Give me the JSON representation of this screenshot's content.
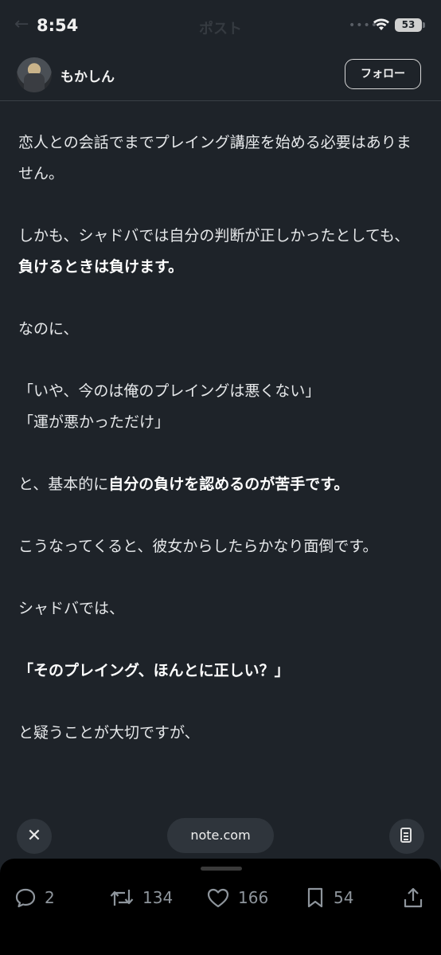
{
  "status_bar": {
    "time": "8:54",
    "title": "ポスト",
    "battery": "53",
    "back_glyph": "←",
    "dots": "••••"
  },
  "header": {
    "username": "もかしん",
    "follow_label": "フォロー"
  },
  "article": {
    "p1": "恋人との会話でまでプレイング講座を始める必要はありません。",
    "p2_plain": "しかも、シャドバでは自分の判断が正しかったとしても、",
    "p2_bold": "負けるときは負けます。",
    "p3": "なのに、",
    "p4_line1": "「いや、今のは俺のプレイングは悪くない」",
    "p4_line2": "「運が悪かっただけ」",
    "p5_plain": "と、基本的に",
    "p5_bold": "自分の負けを認めるのが苦手です。",
    "p6": "こうなってくると、彼女からしたらかなり面倒です。",
    "p7": "シャドバでは、",
    "p8_bold": "「そのプレイング、ほんとに正しい？」",
    "p9": "と疑うことが大切ですが、"
  },
  "browser_bar": {
    "close_glyph": "✕",
    "url": "note.com"
  },
  "actions": {
    "replies": "2",
    "reposts": "134",
    "likes": "166",
    "bookmarks": "54"
  },
  "colors": {
    "background": "#1e2329",
    "text": "#e6e8ea",
    "icon": "#8e959c",
    "sheet": "#000000"
  },
  "icons": [
    "back-arrow-icon",
    "wifi-icon",
    "battery-icon",
    "close-icon",
    "reader-icon",
    "reply-icon",
    "repost-icon",
    "like-icon",
    "bookmark-icon",
    "share-icon"
  ]
}
